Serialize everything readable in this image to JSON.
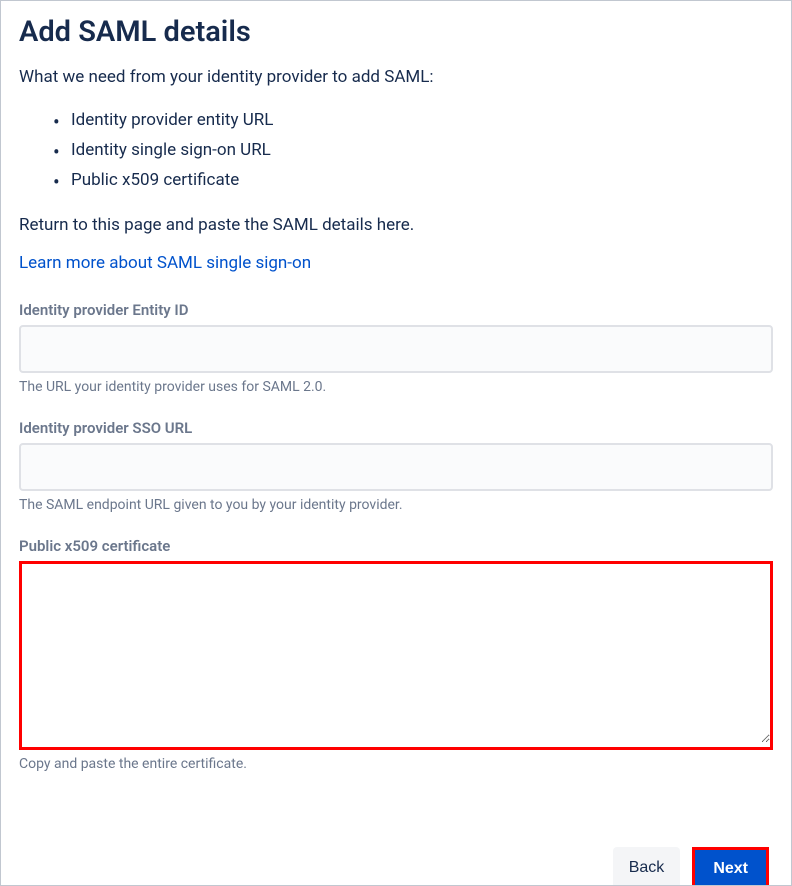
{
  "title": "Add SAML details",
  "intro": "What we need from your identity provider to add SAML:",
  "requirements": [
    "Identity provider entity URL",
    "Identity single sign-on URL",
    "Public x509 certificate"
  ],
  "returnText": "Return to this page and paste the SAML details here.",
  "learnMoreLink": "Learn more about SAML single sign-on",
  "fields": {
    "entityId": {
      "label": "Identity provider Entity ID",
      "value": "",
      "help": "The URL your identity provider uses for SAML 2.0."
    },
    "ssoUrl": {
      "label": "Identity provider SSO URL",
      "value": "",
      "help": "The SAML endpoint URL given to you by your identity provider."
    },
    "x509": {
      "label": "Public x509 certificate",
      "value": "",
      "help": "Copy and paste the entire certificate."
    }
  },
  "buttons": {
    "back": "Back",
    "next": "Next"
  }
}
